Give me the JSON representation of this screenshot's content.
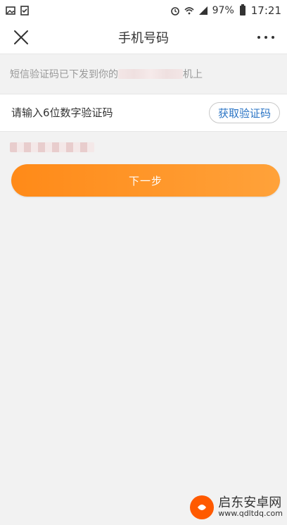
{
  "status_bar": {
    "battery": "97%",
    "time": "17:21",
    "icons": [
      "image-icon",
      "check-icon",
      "alarm-icon",
      "wifi-icon",
      "signal-icon",
      "battery-icon"
    ]
  },
  "nav": {
    "title": "手机号码",
    "close_icon": "close-icon",
    "more_icon": "more-icon"
  },
  "info": {
    "text_before": "短信验证码已下发到你的",
    "text_after": "机上"
  },
  "code_row": {
    "placeholder": "请输入6位数字验证码",
    "button_label": "获取验证码"
  },
  "next_button": {
    "label": "下一步"
  },
  "watermark": {
    "title": "启东安卓网",
    "subtitle": "www.qdltdq.com"
  },
  "colors": {
    "accent": "#ff8a18",
    "link": "#2a74c5"
  }
}
